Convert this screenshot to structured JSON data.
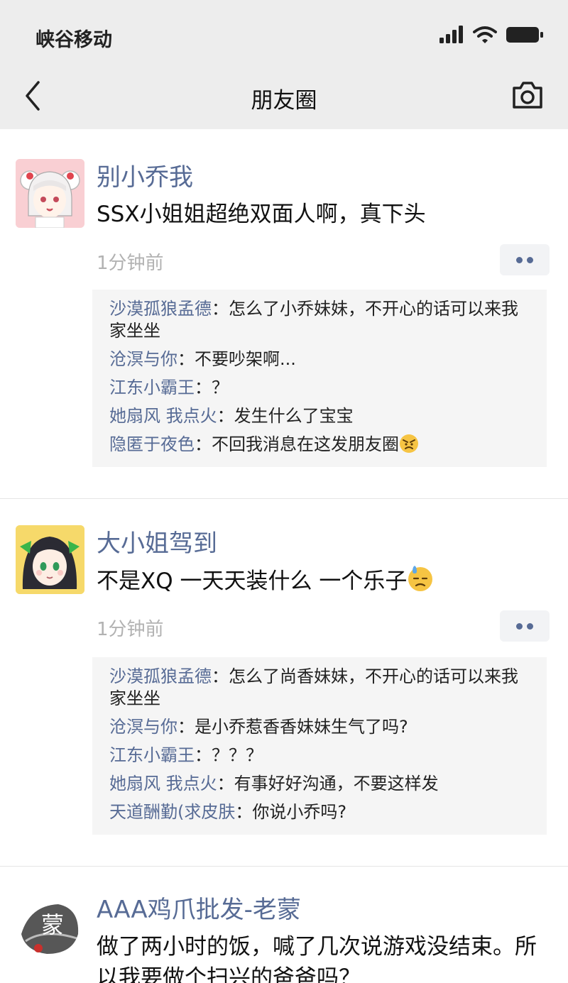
{
  "status_bar": {
    "carrier": "峡谷移动"
  },
  "nav": {
    "title": "朋友圈"
  },
  "posts": [
    {
      "name": "别小乔我",
      "text": "SSX小姐姐超绝双面人啊，真下头",
      "time": "1分钟前",
      "comments": [
        {
          "name": "沙漠孤狼孟德",
          "text": "：怎么了小乔妹妹，不开心的话可以来我家坐坐"
        },
        {
          "name": "沧溟与你",
          "text": "：不要吵架啊..."
        },
        {
          "name": "江东小霸王",
          "text": "：？"
        },
        {
          "name": "她扇风 我点火",
          "text": "：发生什么了宝宝"
        },
        {
          "name": "隐匿于夜色",
          "text": "：不回我消息在这发朋友圈",
          "emoji": "angry-emoji"
        }
      ]
    },
    {
      "name": "大小姐驾到",
      "text": "不是XQ 一天天装什么 一个乐子",
      "text_emoji": "sweat-emoji",
      "time": "1分钟前",
      "comments": [
        {
          "name": "沙漠孤狼孟德",
          "text": "：怎么了尚香妹妹，不开心的话可以来我家坐坐"
        },
        {
          "name": "沧溟与你",
          "text": "：是小乔惹香香妹妹生气了吗?"
        },
        {
          "name": "江东小霸王",
          "text": "：？？？"
        },
        {
          "name": "她扇风 我点火",
          "text": "：有事好好沟通，不要这样发"
        },
        {
          "name": "天道酬勤(求皮肤",
          "text": "：你说小乔吗?"
        }
      ]
    },
    {
      "name": "AAA鸡爪批发-老蒙",
      "text": "做了两小时的饭，喊了几次说游戏没结束。所以我要做个扫兴的爸爸吗？",
      "avatar_glyph": "蒙"
    }
  ]
}
